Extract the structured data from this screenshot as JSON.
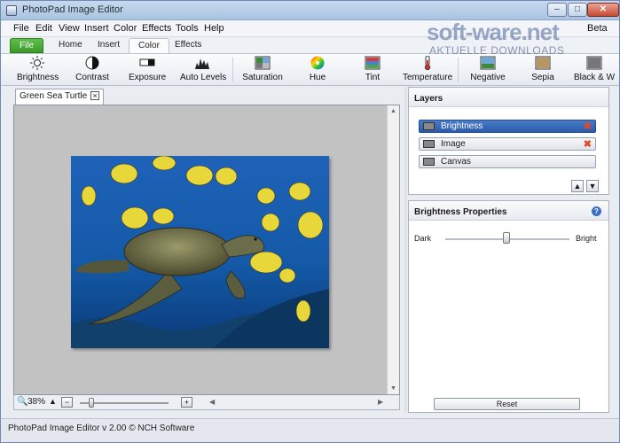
{
  "window": {
    "title": "PhotoPad Image Editor"
  },
  "menu": {
    "items": [
      "File",
      "Edit",
      "View",
      "Insert",
      "Color",
      "Effects",
      "Tools",
      "Help"
    ],
    "right_label": "Beta"
  },
  "ribbon_tabs": {
    "file": "File",
    "home": "Home",
    "insert": "Insert",
    "color": "Color",
    "effects": "Effects"
  },
  "tools": {
    "brightness": "Brightness",
    "contrast": "Contrast",
    "exposure": "Exposure",
    "auto_levels": "Auto Levels",
    "saturation": "Saturation",
    "hue": "Hue",
    "tint": "Tint",
    "temperature": "Temperature",
    "negative": "Negative",
    "sepia": "Sepia",
    "black_white": "Black & W"
  },
  "watermark": {
    "main": "soft-ware.net",
    "sub": "AKTUELLE DOWNLOADS"
  },
  "document": {
    "tab_name": "Green Sea Turtle",
    "close": "☒"
  },
  "zoom": {
    "value": "38%"
  },
  "layers": {
    "title": "Layers",
    "items": [
      {
        "name": "Brightness",
        "delete": "✖"
      },
      {
        "name": "Image",
        "delete": "✖"
      },
      {
        "name": "Canvas"
      }
    ]
  },
  "properties": {
    "title": "Brightness Properties",
    "left_label": "Dark",
    "right_label": "Bright",
    "reset_label": "Reset",
    "slider_level": 0.5
  },
  "status": {
    "text": "PhotoPad Image Editor v 2.00 © NCH Software"
  }
}
